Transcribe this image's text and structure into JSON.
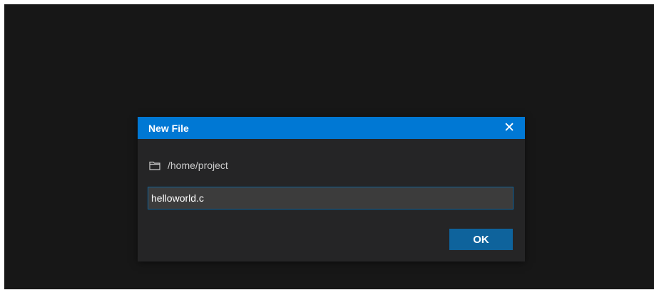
{
  "dialog": {
    "title": "New File",
    "close_glyph": "✕",
    "close_icon": "close-icon",
    "folder_icon": "folder-icon",
    "path": "/home/project",
    "filename_value": "helloworld.c",
    "ok_label": "OK"
  },
  "colors": {
    "titlebar": "#0078d4",
    "dialog_bg": "#252526",
    "backdrop": "#171717",
    "input_bg": "#3c3c3c",
    "input_border": "#0e639c",
    "button_bg": "#0e639c"
  }
}
